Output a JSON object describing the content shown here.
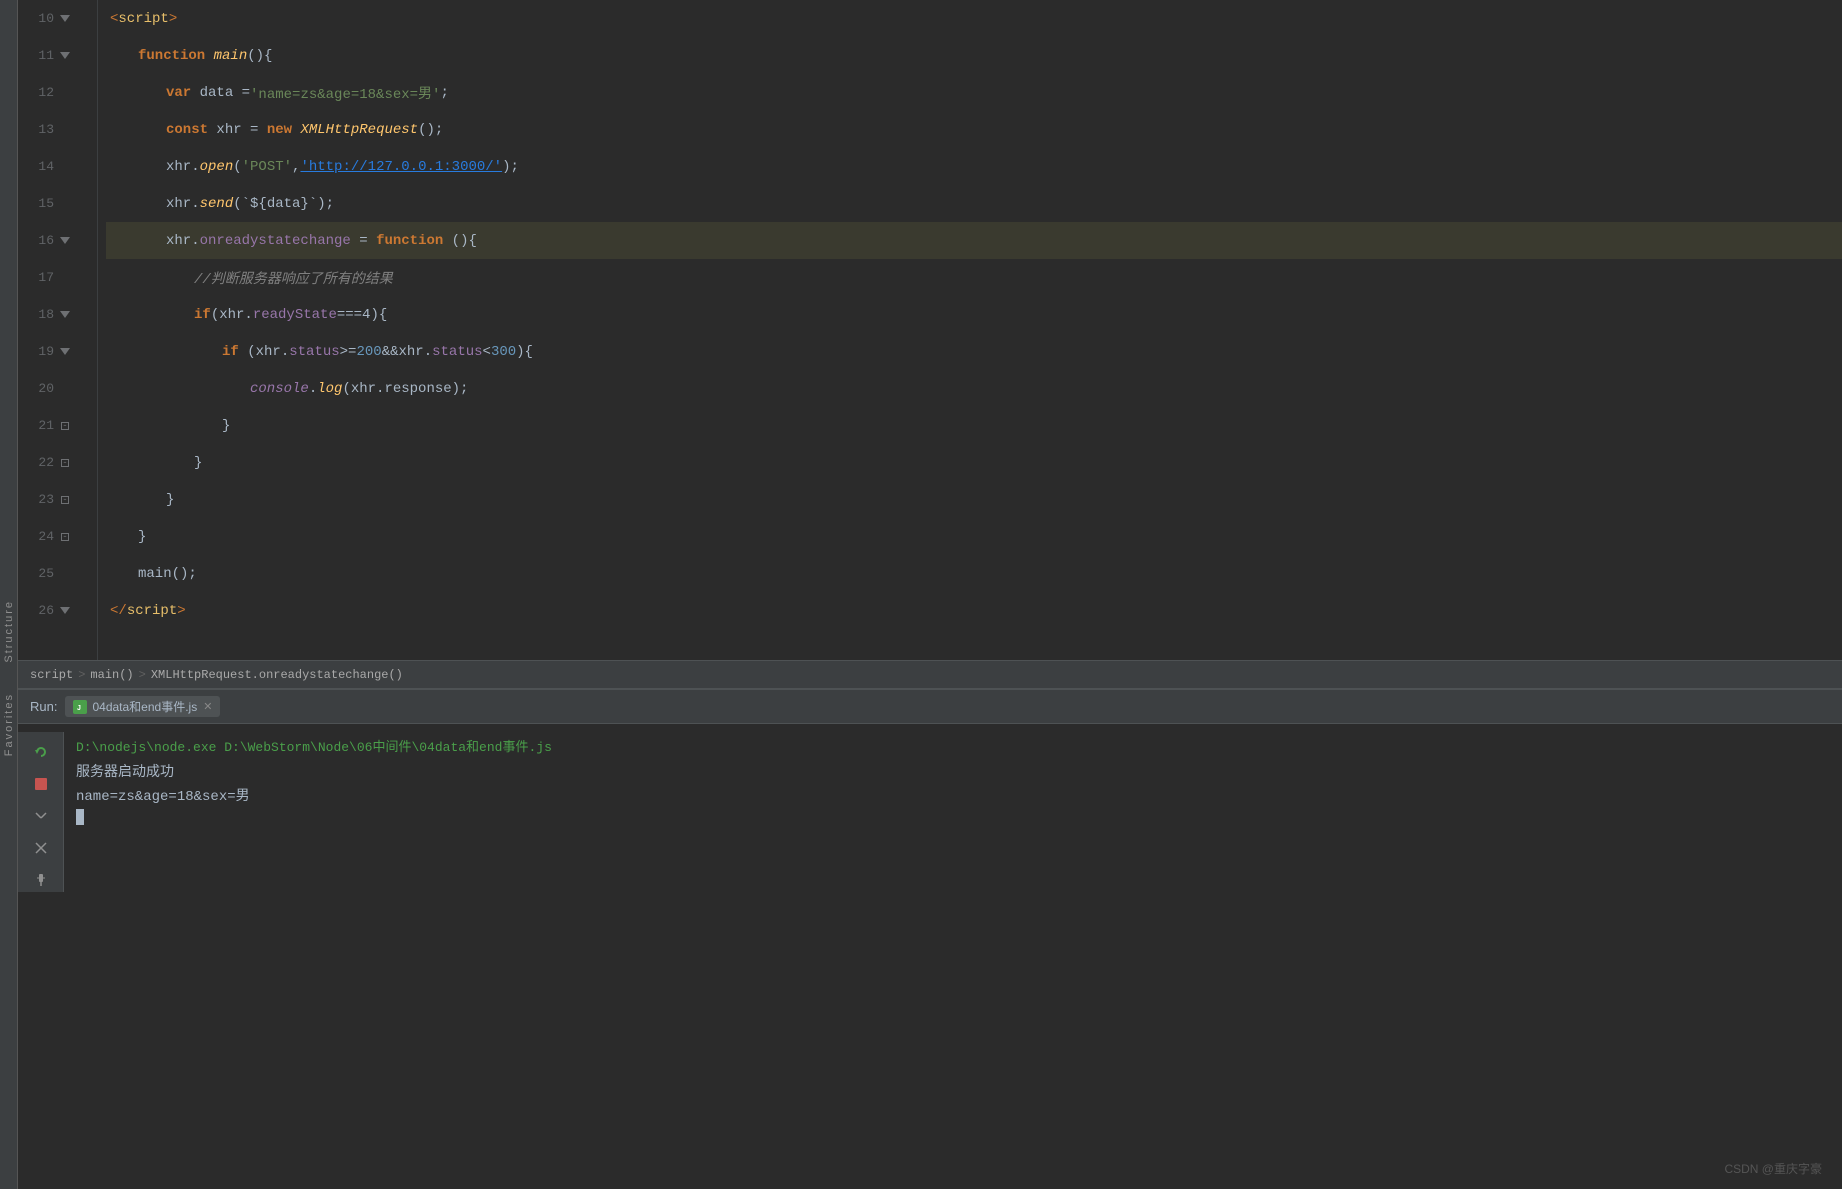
{
  "editor": {
    "lines": [
      {
        "num": "10",
        "hasFold": true,
        "foldType": "triangle",
        "indent": 0,
        "tokens": [
          {
            "type": "angle",
            "text": "<"
          },
          {
            "type": "tag",
            "text": "script"
          },
          {
            "type": "angle",
            "text": ">"
          }
        ],
        "highlighted": false
      },
      {
        "num": "11",
        "hasFold": true,
        "foldType": "triangle",
        "indent": 1,
        "tokens": [
          {
            "type": "kw",
            "text": "function"
          },
          {
            "type": "plain",
            "text": " "
          },
          {
            "type": "fn",
            "text": "main"
          },
          {
            "type": "plain",
            "text": "(){"
          }
        ],
        "highlighted": false
      },
      {
        "num": "12",
        "hasFold": false,
        "indent": 2,
        "tokens": [
          {
            "type": "kw",
            "text": "var"
          },
          {
            "type": "plain",
            "text": " data ="
          },
          {
            "type": "str",
            "text": "'name=zs&age=18&sex=男'"
          },
          {
            "type": "plain",
            "text": ";"
          }
        ],
        "highlighted": false
      },
      {
        "num": "13",
        "hasFold": false,
        "indent": 2,
        "tokens": [
          {
            "type": "kw",
            "text": "const"
          },
          {
            "type": "plain",
            "text": " xhr = "
          },
          {
            "type": "kw",
            "text": "new"
          },
          {
            "type": "plain",
            "text": " "
          },
          {
            "type": "fn",
            "text": "XMLHttpRequest"
          },
          {
            "type": "plain",
            "text": "();"
          }
        ],
        "highlighted": false
      },
      {
        "num": "14",
        "hasFold": false,
        "indent": 2,
        "tokens": [
          {
            "type": "plain",
            "text": "xhr."
          },
          {
            "type": "method",
            "text": "open"
          },
          {
            "type": "plain",
            "text": "("
          },
          {
            "type": "str",
            "text": "'POST'"
          },
          {
            "type": "plain",
            "text": ","
          },
          {
            "type": "link",
            "text": "'http://127.0.0.1:3000/'"
          },
          {
            "type": "plain",
            "text": ");"
          }
        ],
        "highlighted": false
      },
      {
        "num": "15",
        "hasFold": false,
        "indent": 2,
        "tokens": [
          {
            "type": "plain",
            "text": "xhr."
          },
          {
            "type": "method",
            "text": "send"
          },
          {
            "type": "plain",
            "text": "(`${data}`);"
          }
        ],
        "highlighted": false
      },
      {
        "num": "16",
        "hasFold": true,
        "foldType": "triangle",
        "indent": 2,
        "tokens": [
          {
            "type": "plain",
            "text": "xhr."
          },
          {
            "type": "prop",
            "text": "onreadystatechange"
          },
          {
            "type": "plain",
            "text": " = "
          },
          {
            "type": "kw",
            "text": "function"
          },
          {
            "type": "plain",
            "text": " (){"
          }
        ],
        "highlighted": true
      },
      {
        "num": "17",
        "hasFold": false,
        "indent": 3,
        "tokens": [
          {
            "type": "comment",
            "text": "//判断服务器响应了所有的结果"
          }
        ],
        "highlighted": false
      },
      {
        "num": "18",
        "hasFold": true,
        "foldType": "triangle",
        "indent": 3,
        "tokens": [
          {
            "type": "kw",
            "text": "if"
          },
          {
            "type": "plain",
            "text": "(xhr."
          },
          {
            "type": "prop",
            "text": "readyState"
          },
          {
            "type": "plain",
            "text": "===4){"
          }
        ],
        "highlighted": false
      },
      {
        "num": "19",
        "hasFold": true,
        "foldType": "triangle",
        "indent": 4,
        "tokens": [
          {
            "type": "kw",
            "text": "if"
          },
          {
            "type": "plain",
            "text": " (xhr."
          },
          {
            "type": "prop",
            "text": "status"
          },
          {
            "type": "plain",
            "text": ">="
          },
          {
            "type": "num",
            "text": "200"
          },
          {
            "type": "plain",
            "text": "&&xhr."
          },
          {
            "type": "prop",
            "text": "status"
          },
          {
            "type": "plain",
            "text": "<"
          },
          {
            "type": "num",
            "text": "300"
          },
          {
            "type": "plain",
            "text": "){"
          }
        ],
        "highlighted": false
      },
      {
        "num": "20",
        "hasFold": false,
        "indent": 5,
        "tokens": [
          {
            "type": "console-kw",
            "text": "console"
          },
          {
            "type": "plain",
            "text": "."
          },
          {
            "type": "method",
            "text": "log"
          },
          {
            "type": "plain",
            "text": "(xhr.response);"
          }
        ],
        "highlighted": false
      },
      {
        "num": "21",
        "hasFold": false,
        "foldType": "square",
        "indent": 4,
        "tokens": [
          {
            "type": "plain",
            "text": "}"
          }
        ],
        "highlighted": false
      },
      {
        "num": "22",
        "hasFold": false,
        "foldType": "square",
        "indent": 3,
        "tokens": [
          {
            "type": "plain",
            "text": "}"
          }
        ],
        "highlighted": false
      },
      {
        "num": "23",
        "hasFold": false,
        "foldType": "square",
        "indent": 2,
        "tokens": [
          {
            "type": "plain",
            "text": "}"
          }
        ],
        "highlighted": false
      },
      {
        "num": "24",
        "hasFold": false,
        "foldType": "square",
        "indent": 1,
        "tokens": [
          {
            "type": "plain",
            "text": "}"
          }
        ],
        "highlighted": false
      },
      {
        "num": "25",
        "hasFold": false,
        "indent": 1,
        "tokens": [
          {
            "type": "plain",
            "text": "main();"
          }
        ],
        "highlighted": false
      },
      {
        "num": "26",
        "hasFold": true,
        "foldType": "triangle",
        "indent": 0,
        "tokens": [
          {
            "type": "angle",
            "text": "</"
          },
          {
            "type": "tag",
            "text": "script"
          },
          {
            "type": "angle",
            "text": ">"
          }
        ],
        "highlighted": false
      }
    ]
  },
  "breadcrumb": {
    "items": [
      "script",
      "main()",
      "XMLHttpRequest.onreadystatechange()"
    ],
    "separators": [
      ">",
      ">"
    ]
  },
  "run_panel": {
    "label": "Run:",
    "tab_name": "04data和end事件.js",
    "command": "D:\\nodejs\\node.exe D:\\WebStorm\\Node\\06中间件\\04data和end事件.js",
    "output_lines": [
      "服务器启动成功",
      "name=zs&age=18&sex=男"
    ]
  },
  "left_panel": {
    "labels": [
      "Structure",
      "Favorites"
    ]
  },
  "watermark": {
    "text": "CSDN @重庆字豪"
  }
}
